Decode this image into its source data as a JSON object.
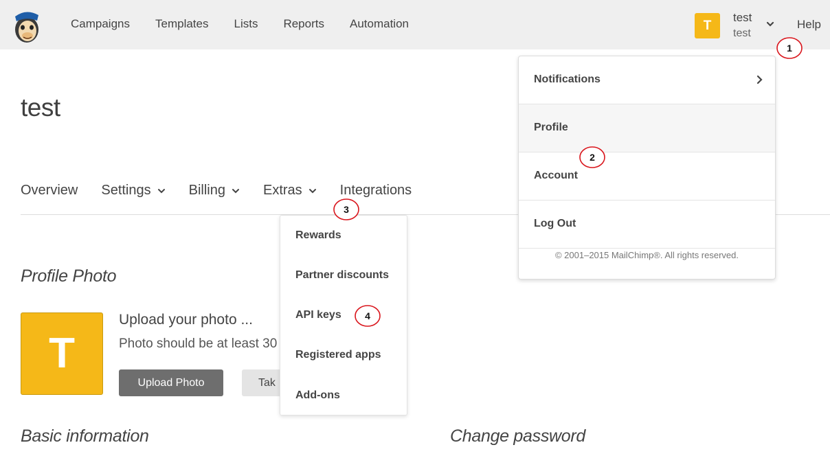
{
  "topbar": {
    "nav": [
      "Campaigns",
      "Templates",
      "Lists",
      "Reports",
      "Automation"
    ],
    "user": {
      "initial": "T",
      "name": "test",
      "org": "test"
    },
    "help_label": "Help"
  },
  "page": {
    "title": "test"
  },
  "subnav": {
    "items": [
      {
        "label": "Overview"
      },
      {
        "label": "Settings"
      },
      {
        "label": "Billing"
      },
      {
        "label": "Extras"
      },
      {
        "label": "Integrations"
      }
    ]
  },
  "extras_menu": {
    "items": [
      "Rewards",
      "Partner discounts",
      "API keys",
      "Registered apps",
      "Add-ons"
    ]
  },
  "user_menu": {
    "items": [
      "Notifications",
      "Profile",
      "Account",
      "Log Out"
    ],
    "footer": "© 2001–2015 MailChimp®. All rights reserved."
  },
  "profile_photo": {
    "heading": "Profile Photo",
    "avatar_initial": "T",
    "upload_title": "Upload your photo ...",
    "upload_desc": "Photo should be at least 30",
    "upload_button": "Upload Photo",
    "take_button": "Tak"
  },
  "sections": {
    "basic_information": "Basic information",
    "change_password": "Change password"
  },
  "callouts": [
    "1",
    "2",
    "3",
    "4"
  ],
  "colors": {
    "accent_yellow": "#f5b818",
    "topbar_bg": "#efefef",
    "callout_red": "#d9141b",
    "button_dark": "#6e6e6e"
  }
}
